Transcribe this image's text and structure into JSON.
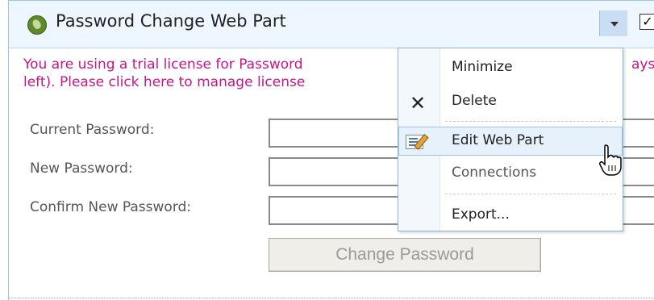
{
  "webpart": {
    "title": "Password Change Web Part",
    "icon": "webpart-leaf-icon",
    "checkbox_mark": "✓"
  },
  "license": {
    "line1": "You are using a trial license for Password",
    "line1_end": "ays",
    "line2": "left). Please click here to manage license"
  },
  "form": {
    "current_label": "Current Password:",
    "new_label": "New Password:",
    "confirm_label": "Confirm New Password:",
    "current_value": "",
    "new_value": "",
    "confirm_value": "",
    "submit_label": "Change Password"
  },
  "menu": {
    "items": [
      {
        "label": "Minimize",
        "icon": ""
      },
      {
        "label": "Delete",
        "icon": "close-x-icon"
      },
      {
        "label": "Edit Web Part",
        "icon": "edit-page-icon"
      },
      {
        "label": "Connections",
        "icon": ""
      },
      {
        "label": "Export...",
        "icon": ""
      }
    ]
  },
  "colors": {
    "license_text": "#c7158a",
    "header_bg": "#eef6ff",
    "border": "#9fc3e6",
    "menu_highlight": "#e7f1fb"
  }
}
